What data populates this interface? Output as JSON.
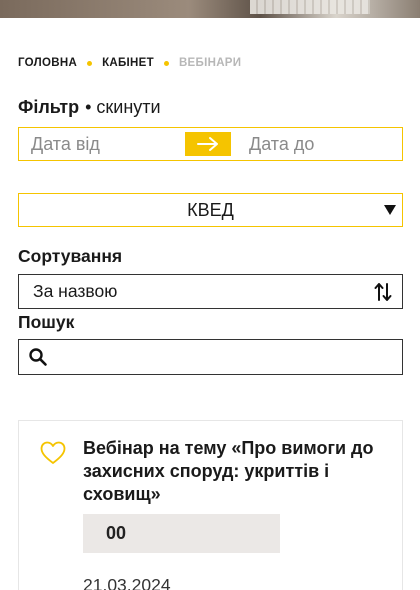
{
  "breadcrumb": {
    "items": [
      {
        "label": "ГОЛОВНА"
      },
      {
        "label": "КАБІНЕТ"
      },
      {
        "label": "ВЕБІНАРИ"
      }
    ]
  },
  "filter": {
    "title": "Фільтр",
    "separator": "•",
    "reset_label": "скинути",
    "date_from_placeholder": "Дата від",
    "date_to_placeholder": "Дата до",
    "arrow_icon": "arrow-right-icon",
    "kved_label": "КВЕД",
    "kved_caret_icon": "caret-down-icon"
  },
  "sort": {
    "label": "Сортування",
    "value": "За назвою",
    "icon": "sort-arrows-icon"
  },
  "search": {
    "label": "Пошук",
    "placeholder": "",
    "icon": "search-icon"
  },
  "webinar": {
    "title": "Вебінар на тему «Про вимоги до захисних споруд: укриттів і сховищ»",
    "counter": "00",
    "date": "21.03.2024",
    "favorite_icon": "heart-outline-icon"
  },
  "colors": {
    "accent": "#f5c400",
    "text": "#1a1a1a",
    "muted": "#b7b7b7",
    "counter_bg": "#ebe8e6"
  }
}
